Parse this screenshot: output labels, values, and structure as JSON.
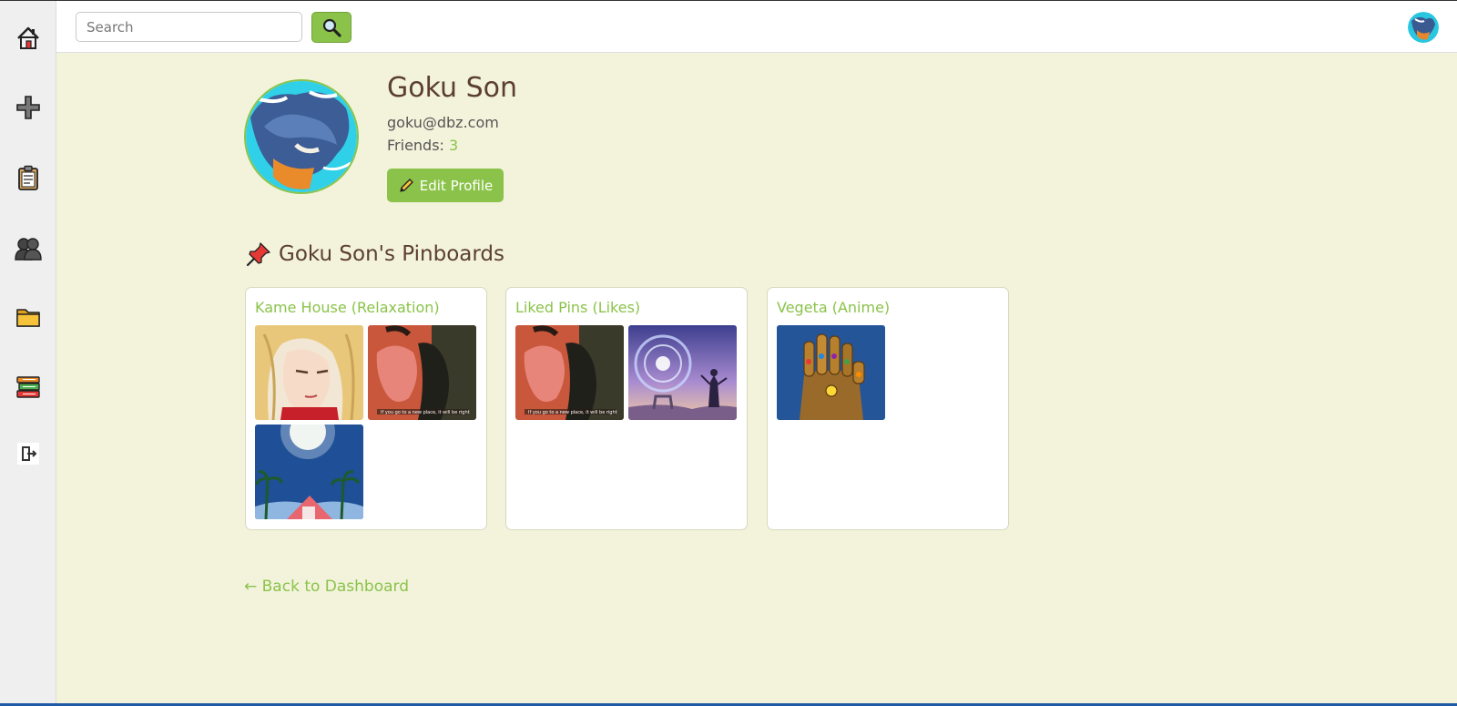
{
  "sidebar": {
    "items": [
      {
        "name": "home",
        "icon": "home-icon"
      },
      {
        "name": "create",
        "icon": "plus-icon"
      },
      {
        "name": "clipboard",
        "icon": "clipboard-icon"
      },
      {
        "name": "friends",
        "icon": "people-icon"
      },
      {
        "name": "folder",
        "icon": "folder-icon"
      },
      {
        "name": "library",
        "icon": "books-icon"
      },
      {
        "name": "logout",
        "icon": "logout-icon"
      }
    ]
  },
  "topbar": {
    "search_placeholder": "Search",
    "search_value": "",
    "search_button_icon": "magnifier-icon"
  },
  "profile": {
    "name": "Goku Son",
    "email": "goku@dbz.com",
    "friends_label": "Friends: ",
    "friends_count": "3",
    "edit_label": "Edit Profile"
  },
  "pinboards_title": "Goku Son's Pinboards",
  "boards": [
    {
      "title": "Kame House (Relaxation)",
      "pins": [
        "blonde-anime-woman",
        "lofi-anime-couple",
        "kame-house-night"
      ]
    },
    {
      "title": "Liked Pins (Likes)",
      "pins": [
        "lofi-anime-couple",
        "fantasy-portal-girl"
      ]
    },
    {
      "title": "Vegeta (Anime)",
      "pins": [
        "infinity-gauntlet"
      ]
    }
  ],
  "back_link": "← Back to Dashboard",
  "colors": {
    "accent": "#8bc34a",
    "background": "#f3f3dc",
    "heading": "#5b3f2e"
  }
}
